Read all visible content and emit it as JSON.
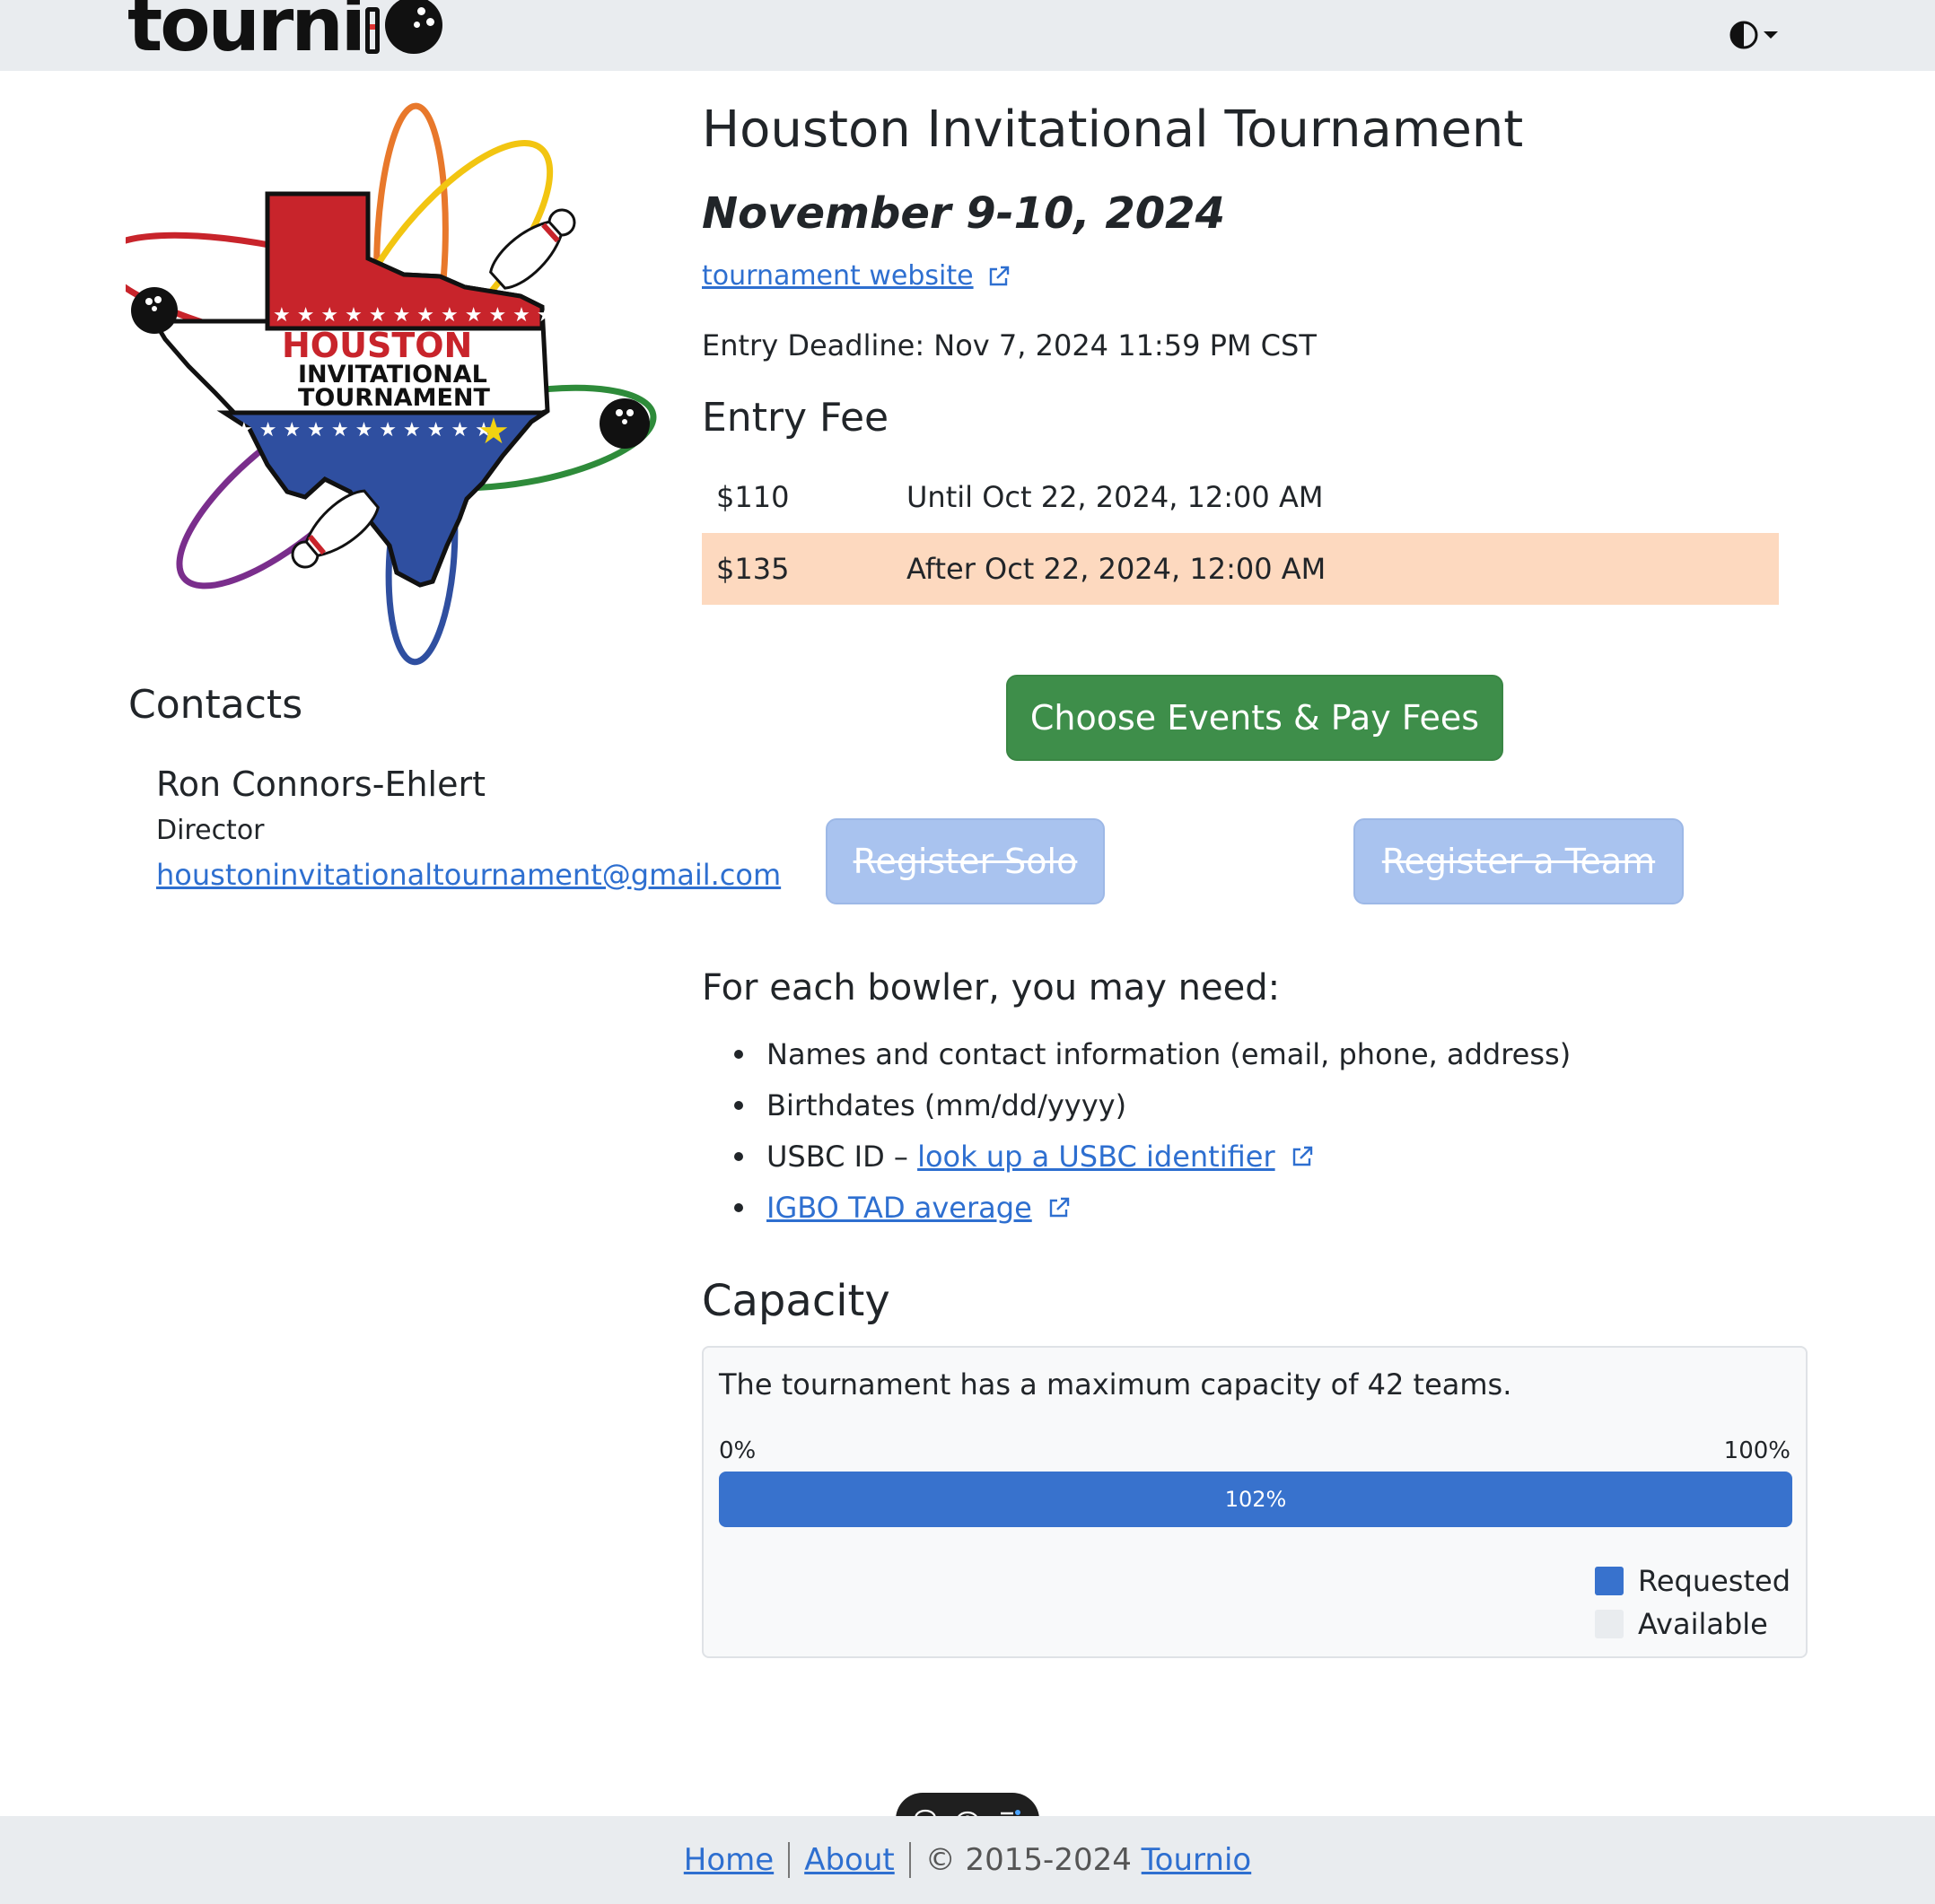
{
  "header": {
    "brand": "tourni",
    "theme_toggle_icon": "half-circle-icon"
  },
  "tournament": {
    "title": "Houston Invitational Tournament",
    "dates": "November 9-10, 2024",
    "website_label": "tournament website",
    "deadline": "Entry Deadline: Nov 7, 2024 11:59 PM CST",
    "logo": {
      "word1": "HOUSTON",
      "word2": "INVITATIONAL",
      "word3": "TOURNAMENT"
    }
  },
  "entry_fee": {
    "heading": "Entry Fee",
    "rows": [
      {
        "amount": "$110",
        "when": "Until Oct 22, 2024, 12:00 AM",
        "current": false
      },
      {
        "amount": "$135",
        "when": "After Oct 22, 2024, 12:00 AM",
        "current": true
      }
    ],
    "highlight_color": "#fdd9bf"
  },
  "actions": {
    "primary": "Choose Events & Pay Fees",
    "solo": "Register Solo",
    "team": "Register a Team",
    "primary_color": "#3e8e4a",
    "disabled_color": "#a9c3ef"
  },
  "contacts": {
    "heading": "Contacts",
    "name": "Ron Connors-Ehlert",
    "role": "Director",
    "email": "houstoninvitationaltournament@gmail.com"
  },
  "requirements": {
    "heading": "For each bowler, you may need:",
    "items": [
      {
        "text": "Names and contact information (email, phone, address)"
      },
      {
        "text": "Birthdates (mm/dd/yyyy)"
      },
      {
        "text": "USBC ID – ",
        "link": "look up a USBC identifier"
      },
      {
        "link": "IGBO TAD average"
      }
    ]
  },
  "capacity": {
    "heading": "Capacity",
    "description": "The tournament has a maximum capacity of 42 teams.",
    "min_label": "0%",
    "max_label": "100%",
    "bar_label": "102%",
    "requested_fraction": 1.0,
    "legend": [
      {
        "label": "Requested",
        "color": "#3872cd"
      },
      {
        "label": "Available",
        "color": "#e9ecef"
      }
    ]
  },
  "toolbar": {
    "icons": [
      "comment-icon",
      "eye-icon",
      "menu-icon"
    ]
  },
  "footer": {
    "home": "Home",
    "about": "About",
    "copyright": "© 2015-2024 ",
    "brand_link": "Tournio"
  },
  "colors": {
    "link": "#2e6fd0",
    "topbar": "#e9ecef"
  }
}
